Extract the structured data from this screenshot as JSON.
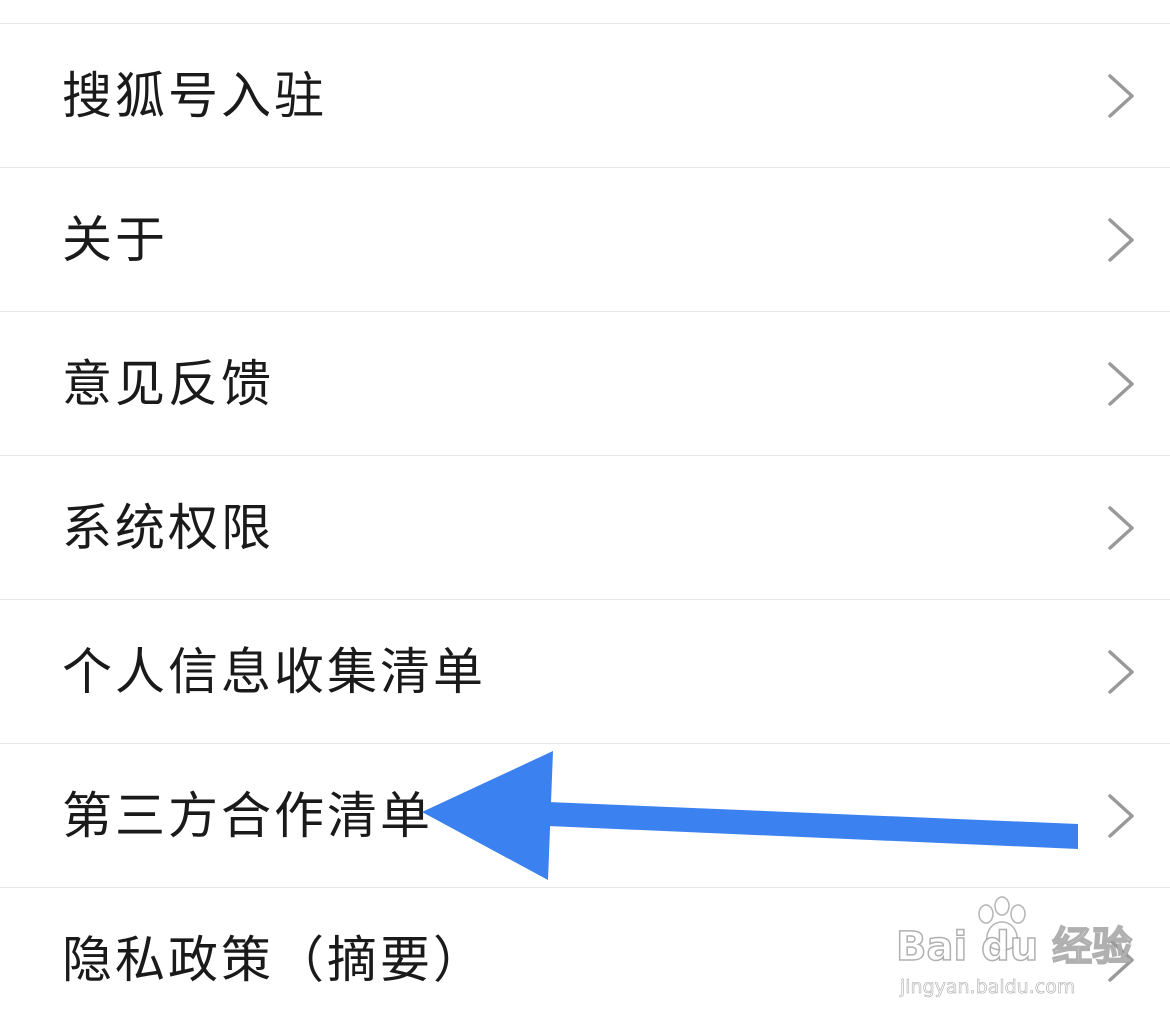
{
  "settings_list": {
    "items": [
      {
        "label": "搜狐号入驻"
      },
      {
        "label": "关于"
      },
      {
        "label": "意见反馈"
      },
      {
        "label": "系统权限"
      },
      {
        "label": "个人信息收集清单"
      },
      {
        "label": "第三方合作清单"
      },
      {
        "label": "隐私政策（摘要）"
      }
    ],
    "chevron_icon": "chevron-right-icon"
  },
  "annotation": {
    "icon": "arrow-left-icon",
    "color": "#3b82f0",
    "points_to": "第三方合作清单"
  },
  "watermark": {
    "brand": "Bai du 经验",
    "url": "jingyan.baidu.com"
  }
}
